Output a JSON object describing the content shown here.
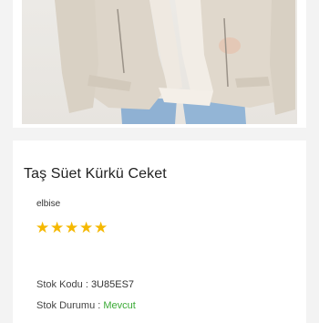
{
  "product": {
    "image_alt": "Taş Süet Kürkü Ceket fotoğrafı",
    "title": "Taş Süet Kürkü Ceket",
    "category": "elbise",
    "rating": 5,
    "rating_max": 5,
    "stock_code_label": "Stok Kodu : ",
    "stock_code_value": "3U85ES7",
    "stock_status_label": "Stok Durumu : ",
    "stock_status_value": "Mevcut"
  },
  "colors": {
    "star": "#f5b800",
    "in_stock": "#3aaa35",
    "page_bg": "#f3f3f3"
  }
}
